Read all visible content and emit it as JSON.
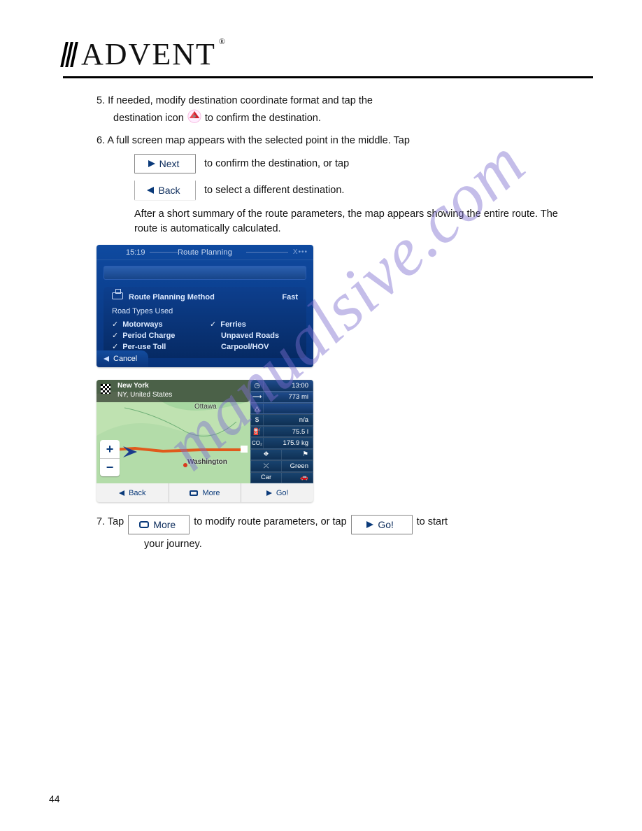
{
  "brand": {
    "name": "ADVENT",
    "reg": "®"
  },
  "steps": {
    "s5_a": "5.  If needed, modify destination coordinate format and tap the ",
    "s5_b": "destination icon ",
    "s5_c": " to confirm the destination.",
    "s6_a": "6.  A full screen map appears with the selected point in the middle. Tap ",
    "s6_b": " to confirm the destination, or tap ",
    "s6_c": " to select a different destination.",
    "s6_d": "After a short summary of the route parameters, the map appears showing the entire route. The route is automatically calculated.",
    "s7_a": "7.  Tap ",
    "s7_b": " to modify route parameters, or tap ",
    "s7_c": " to start",
    "s7_d": "your journey."
  },
  "buttons": {
    "next": "Next",
    "back": "Back",
    "more": "More",
    "go": "Go!"
  },
  "screenshot1": {
    "time": "15:19",
    "title": "Route Planning",
    "sysicons": "X•••",
    "method_label": "Route Planning Method",
    "method_value": "Fast",
    "subhead": "Road Types Used",
    "opts": {
      "motorways": "Motorways",
      "period": "Period Charge",
      "peruse": "Per-use Toll",
      "ferries": "Ferries",
      "unpaved": "Unpaved Roads",
      "carpool": "Carpool/HOV"
    },
    "cancel": "Cancel"
  },
  "screenshot2": {
    "dest_line1": "New York",
    "dest_line2": "NY, United States",
    "city_ottawa": "Ottawa",
    "city_wash": "Washington",
    "side": {
      "clock": "13:00",
      "dist": "773 mi",
      "cost": "n/a",
      "fuel": "75.5 l",
      "co2": "175.9 kg",
      "green_label": "Green",
      "car": "Car"
    },
    "bar": {
      "back": "Back",
      "more": "More",
      "go": "Go!"
    },
    "zoom_plus": "+",
    "zoom_minus": "−"
  },
  "watermark": "manualsive.com",
  "page_number": "44"
}
